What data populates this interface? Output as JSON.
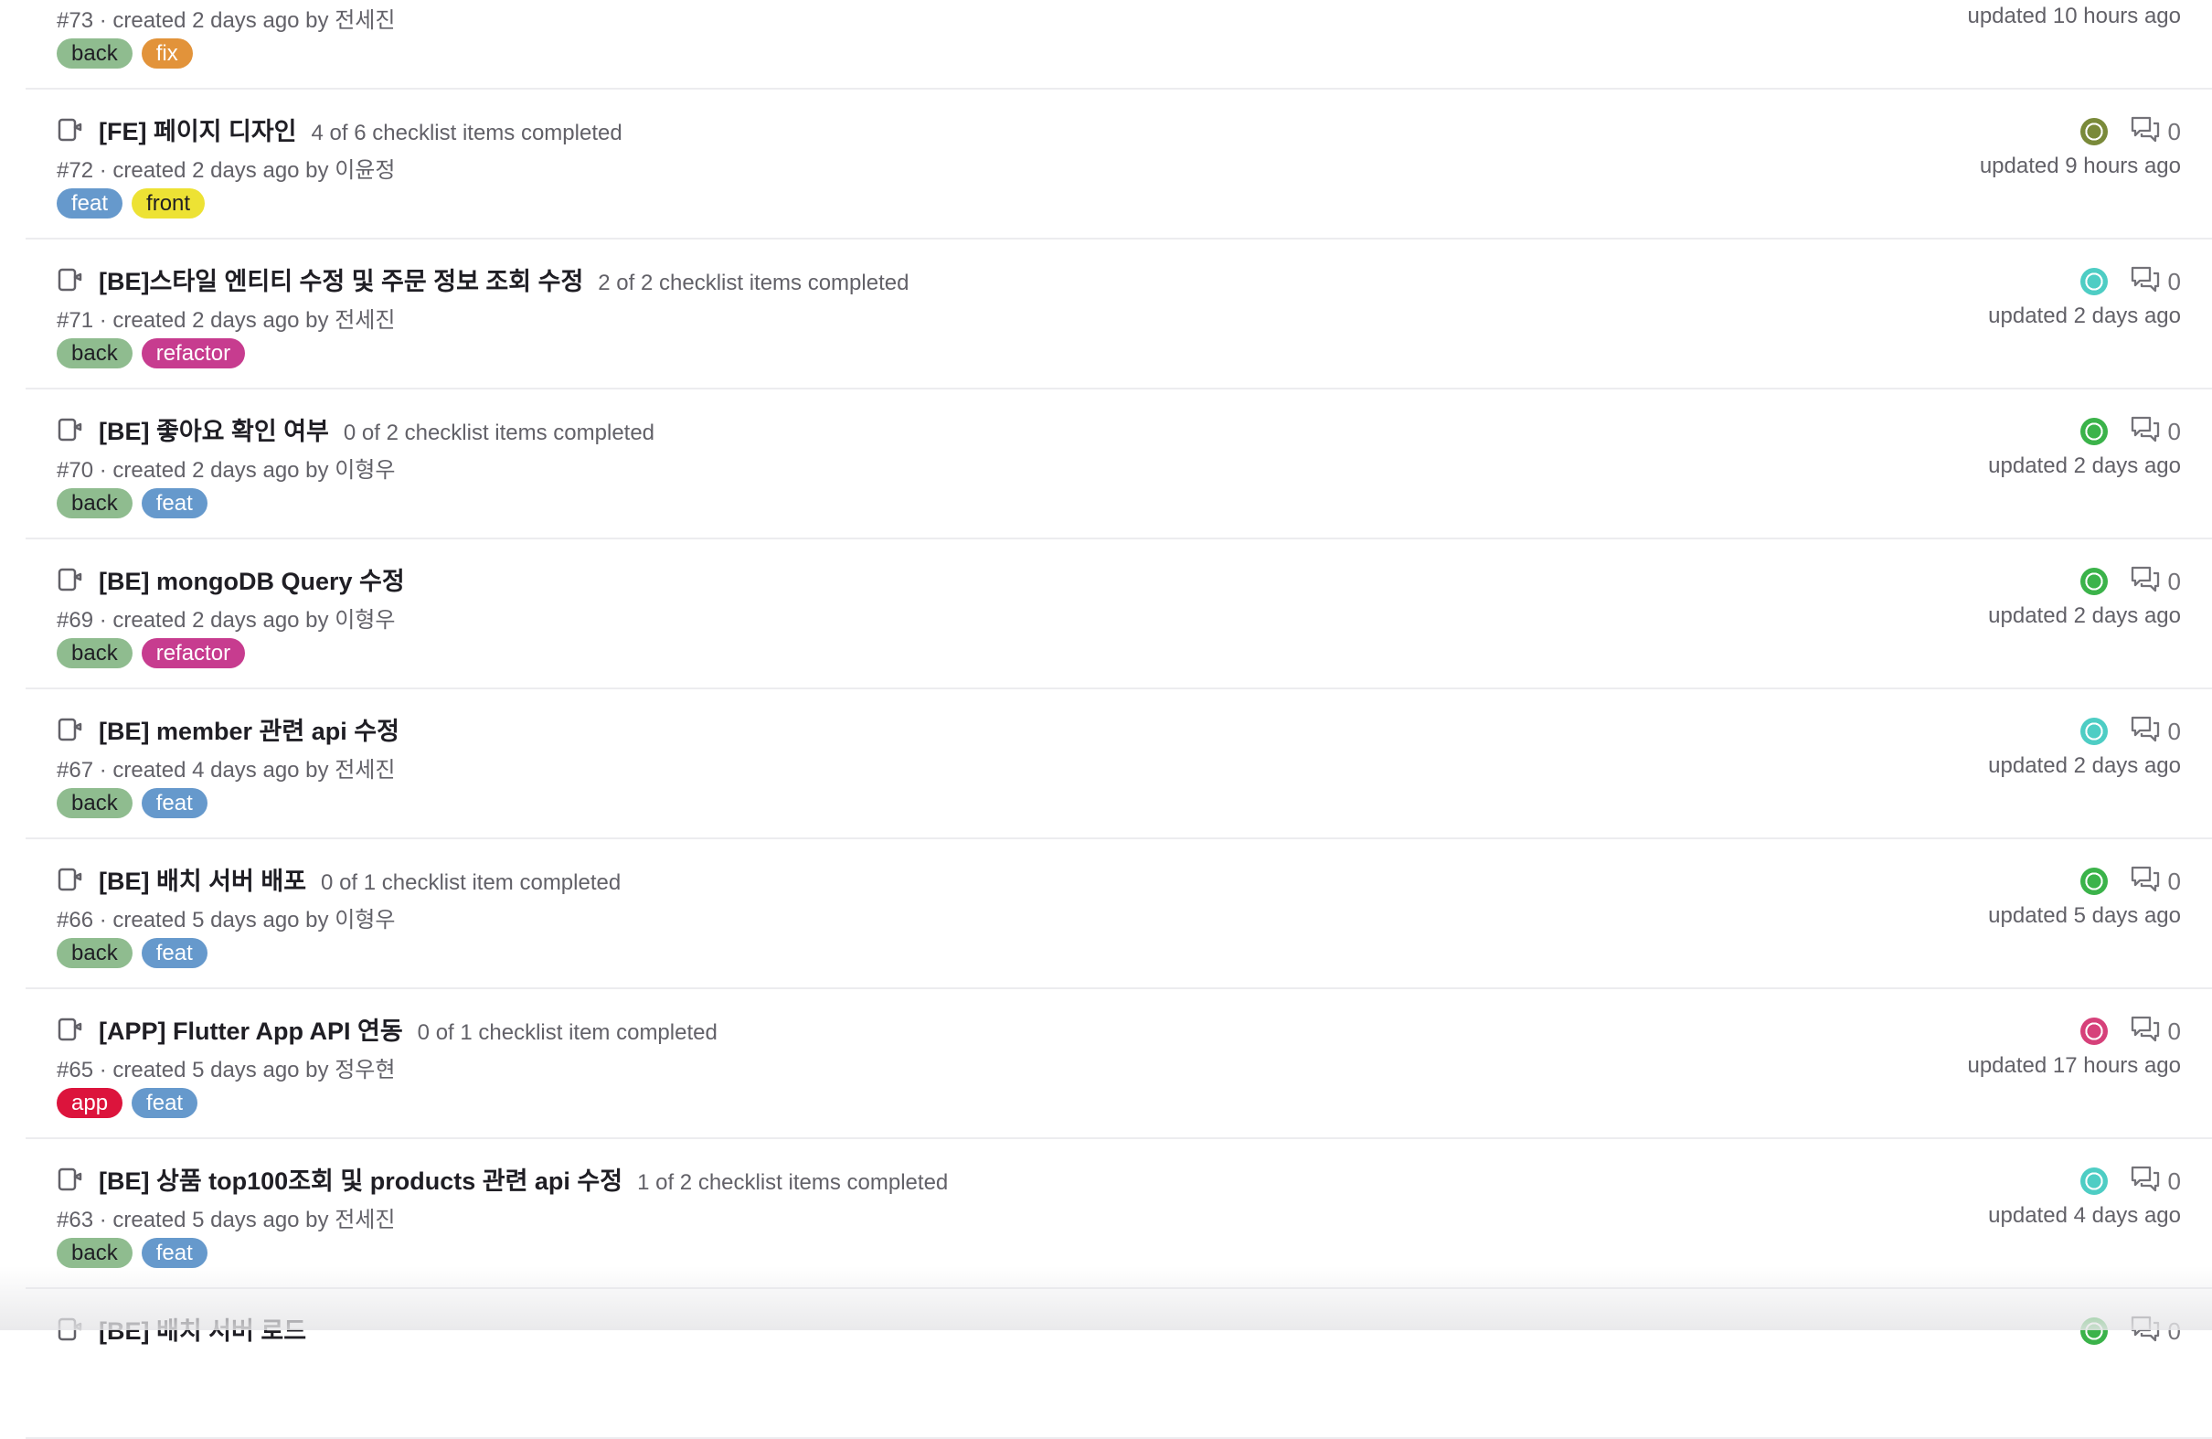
{
  "issues": [
    {
      "title": "",
      "checklist": "",
      "meta": "#73 · created 2 days ago by 전세진",
      "labels": [
        {
          "text": "back",
          "cls": "lbl-back"
        },
        {
          "text": "fix",
          "cls": "lbl-fix"
        }
      ],
      "avatar_color": "",
      "comments": "",
      "updated": "updated 10 hours ago"
    },
    {
      "title": "[FE] 페이지 디자인",
      "checklist": "4 of 6 checklist items completed",
      "meta": "#72 · created 2 days ago by 이윤정",
      "labels": [
        {
          "text": "feat",
          "cls": "lbl-feat"
        },
        {
          "text": "front",
          "cls": "lbl-front"
        }
      ],
      "avatar_color": "#7a8a3a",
      "comments": "0",
      "updated": "updated 9 hours ago"
    },
    {
      "title": "[BE]스타일 엔티티 수정 및 주문 정보 조회 수정",
      "checklist": "2 of 2 checklist items completed",
      "meta": "#71 · created 2 days ago by 전세진",
      "labels": [
        {
          "text": "back",
          "cls": "lbl-back"
        },
        {
          "text": "refactor",
          "cls": "lbl-refactor"
        }
      ],
      "avatar_color": "#4ecdc4",
      "comments": "0",
      "updated": "updated 2 days ago"
    },
    {
      "title": "[BE] 좋아요 확인 여부",
      "checklist": "0 of 2 checklist items completed",
      "meta": "#70 · created 2 days ago by 이형우",
      "labels": [
        {
          "text": "back",
          "cls": "lbl-back"
        },
        {
          "text": "feat",
          "cls": "lbl-feat"
        }
      ],
      "avatar_color": "#3bb34a",
      "comments": "0",
      "updated": "updated 2 days ago"
    },
    {
      "title": "[BE] mongoDB Query 수정",
      "checklist": "",
      "meta": "#69 · created 2 days ago by 이형우",
      "labels": [
        {
          "text": "back",
          "cls": "lbl-back"
        },
        {
          "text": "refactor",
          "cls": "lbl-refactor"
        }
      ],
      "avatar_color": "#3bb34a",
      "comments": "0",
      "updated": "updated 2 days ago"
    },
    {
      "title": "[BE] member 관련 api 수정",
      "checklist": "",
      "meta": "#67 · created 4 days ago by 전세진",
      "labels": [
        {
          "text": "back",
          "cls": "lbl-back"
        },
        {
          "text": "feat",
          "cls": "lbl-feat"
        }
      ],
      "avatar_color": "#4ecdc4",
      "comments": "0",
      "updated": "updated 2 days ago"
    },
    {
      "title": "[BE] 배치 서버 배포",
      "checklist": "0 of 1 checklist item completed",
      "meta": "#66 · created 5 days ago by 이형우",
      "labels": [
        {
          "text": "back",
          "cls": "lbl-back"
        },
        {
          "text": "feat",
          "cls": "lbl-feat"
        }
      ],
      "avatar_color": "#3bb34a",
      "comments": "0",
      "updated": "updated 5 days ago"
    },
    {
      "title": "[APP] Flutter App API 연동",
      "checklist": "0 of 1 checklist item completed",
      "meta": "#65 · created 5 days ago by 정우현",
      "labels": [
        {
          "text": "app",
          "cls": "lbl-app"
        },
        {
          "text": "feat",
          "cls": "lbl-feat"
        }
      ],
      "avatar_color": "#d6417a",
      "comments": "0",
      "updated": "updated 17 hours ago"
    },
    {
      "title": "[BE] 상품 top100조회 및 products 관련 api 수정",
      "checklist": "1 of 2 checklist items completed",
      "meta": "#63 · created 5 days ago by 전세진",
      "labels": [
        {
          "text": "back",
          "cls": "lbl-back"
        },
        {
          "text": "feat",
          "cls": "lbl-feat"
        }
      ],
      "avatar_color": "#4ecdc4",
      "comments": "0",
      "updated": "updated 4 days ago"
    },
    {
      "title": "[BE] 배치 서버 로드",
      "checklist": "",
      "meta": "",
      "labels": [],
      "avatar_color": "#3bb34a",
      "comments": "0",
      "updated": ""
    }
  ]
}
